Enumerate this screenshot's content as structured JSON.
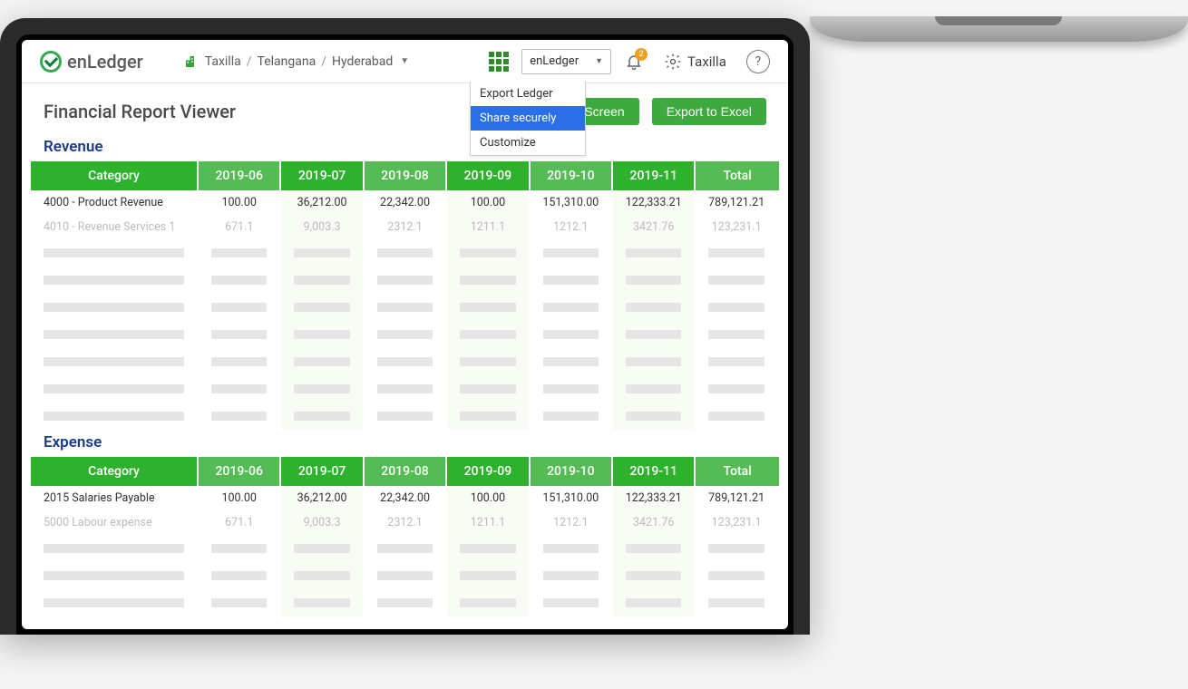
{
  "header": {
    "logo_text": "enLedger",
    "breadcrumb": [
      "Taxilla",
      "Telangana",
      "Hyderabad"
    ],
    "app_select_value": "enLedger",
    "notifications_count": "2",
    "user_name": "Taxilla",
    "help_label": "?"
  },
  "dropdown": {
    "items": [
      {
        "label": "Export Ledger",
        "active": false
      },
      {
        "label": "Share securely",
        "active": true
      },
      {
        "label": "Customize",
        "active": false
      }
    ]
  },
  "page": {
    "title": "Financial Report Viewer",
    "print_label": "Print Screen",
    "export_label": "Export to Excel"
  },
  "tables": [
    {
      "title": "Revenue",
      "columns": [
        "Category",
        "2019-06",
        "2019-07",
        "2019-08",
        "2019-09",
        "2019-10",
        "2019-11",
        "Total"
      ],
      "rows": [
        {
          "cat": "4000 - Product Revenue",
          "vals": [
            "100.00",
            "36,212.00",
            "22,342.00",
            "100.00",
            "151,310.00",
            "122,333.21",
            "789,121.21"
          ],
          "faded": false
        },
        {
          "cat": "4010 - Revenue Services 1",
          "vals": [
            "671.1",
            "9,003.3",
            "2312.1",
            "1211.1",
            "1212.1",
            "3421.76",
            "123,231.1"
          ],
          "faded": true
        }
      ],
      "skeleton_rows": 7
    },
    {
      "title": "Expense",
      "columns": [
        "Category",
        "2019-06",
        "2019-07",
        "2019-08",
        "2019-09",
        "2019-10",
        "2019-11",
        "Total"
      ],
      "rows": [
        {
          "cat": "2015 Salaries Payable",
          "vals": [
            "100.00",
            "36,212.00",
            "22,342.00",
            "100.00",
            "151,310.00",
            "122,333.21",
            "789,121.21"
          ],
          "faded": false
        },
        {
          "cat": "5000 Labour expense",
          "vals": [
            "671.1",
            "9,003.3",
            "2312.1",
            "1211.1",
            "1212.1",
            "3421.76",
            "123,231.1"
          ],
          "faded": true
        }
      ],
      "skeleton_rows": 3
    }
  ]
}
